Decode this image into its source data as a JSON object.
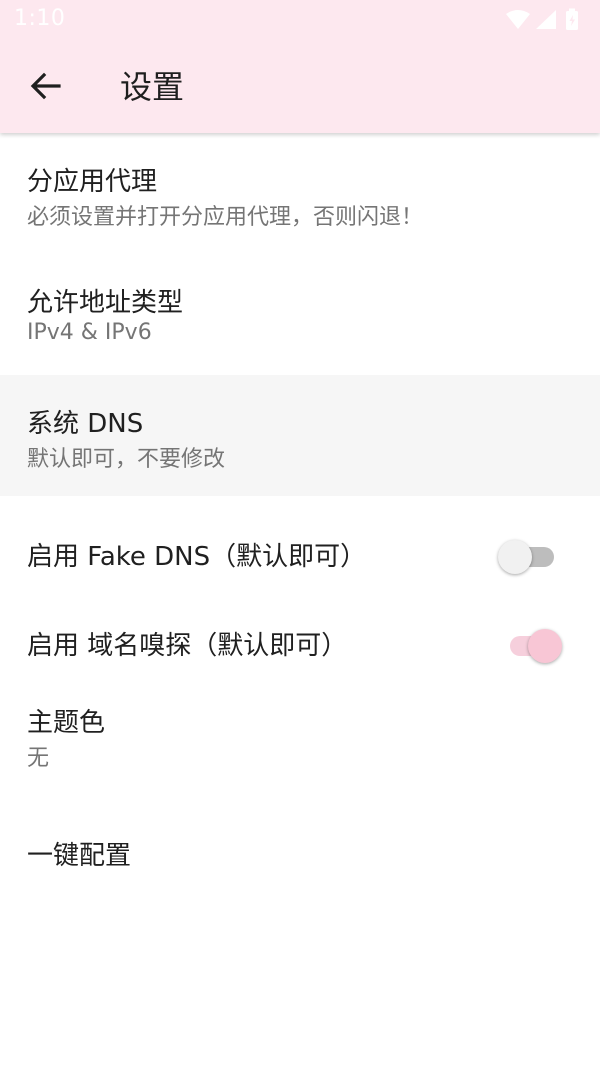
{
  "status_bar": {
    "time": "1:10",
    "icons": [
      "wifi-icon",
      "signal-icon",
      "battery-icon"
    ]
  },
  "app_bar": {
    "back_icon": "arrow-back-icon",
    "title": "设置",
    "background": "#fde8ef"
  },
  "settings": [
    {
      "title": "分应用代理",
      "subtitle": "必须设置并打开分应用代理，否则闪退！"
    },
    {
      "title": "允许地址类型",
      "subtitle": "IPv4 & IPv6"
    },
    {
      "title": "系统 DNS",
      "subtitle": "默认即可，不要修改"
    },
    {
      "title": "启用 Fake DNS（默认即可）",
      "switch_on": false
    },
    {
      "title": "启用 域名嗅探（默认即可）",
      "switch_on": true
    },
    {
      "title": "主题色",
      "subtitle": "无"
    },
    {
      "title": "一键配置"
    }
  ],
  "colors": {
    "accent": "#f8c6d5",
    "switch_off_track": "#bdbdbd"
  }
}
